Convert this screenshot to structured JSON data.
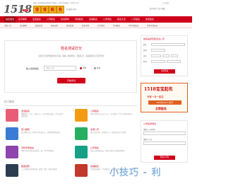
{
  "top_strip": {
    "notice": "看盘人查询网站名测试打分网站，起名打分网站 - 1518.com",
    "right": "宝宝起名"
  },
  "header": {
    "logo_text": "1518",
    "logo_badge": ".com",
    "banner_chars": [
      "宝",
      "宝",
      "起",
      "名"
    ],
    "banner_sub": "宝宝起名大师",
    "right_link": "设为首页 | 加入收藏"
  },
  "nav": {
    "items": [
      "姓名测试",
      "名字解梦",
      "宝宝起名",
      "公司起名",
      "在线算命",
      "周易起名",
      "店铺起名",
      "公司测名",
      "起名大全",
      "八字起名",
      "免费起名"
    ],
    "active_index": 0
  },
  "subnav": {
    "items": [
      "生辰八字",
      "周公解梦",
      "黄道吉日",
      "星座运势",
      "姓氏起源",
      "起名字典",
      "五行查询",
      "生肖配对",
      "QQ号测吉凶",
      "手机号测吉凶"
    ]
  },
  "test_panel": {
    "title": "姓名测试打分",
    "desc": "好的名字是伴随终生的幸福，请输入您的姓名，测试打分，看看您的名字是否吉祥",
    "name_label": "输入您的姓名",
    "name_placeholder": "请输入姓名",
    "gender_male": "男性",
    "gender_female": "女性",
    "submit_label": "开始测试"
  },
  "hot": {
    "heading": "热门服务",
    "services": [
      {
        "name": "宝宝起名",
        "desc": "根据姓氏、生日、生辰八字、五行等综合起名，为宝宝起个吉祥好名",
        "color": "#e85d75",
        "icon": "baby-icon"
      },
      {
        "name": "公司起名",
        "desc": "结合行业特点与五行八字，为公司取一个大气吉利的好名字",
        "color": "#f39c12",
        "icon": "building-icon"
      },
      {
        "name": "周公解梦",
        "desc": "周公解梦大全，梦见什么代表什么，在线查询梦境吉凶",
        "color": "#3a7bd5",
        "icon": "moon-icon"
      },
      {
        "name": "生辰八字",
        "desc": "输入出生时间，在线排八字，分析命局五行与运势",
        "color": "#27ae60",
        "icon": "calendar-icon"
      },
      {
        "name": "手机号测吉凶",
        "desc": "测试手机号码的吉凶好坏，选一个好号码助运",
        "color": "#8e44ad",
        "icon": "phone-icon"
      },
      {
        "name": "公司测名",
        "desc": "测试公司名称吉凶，分析公司名字对运势的影响",
        "color": "#16a085",
        "icon": "chart-icon"
      },
      {
        "name": "星座运势",
        "desc": "十二星座每日运势查询，爱情、事业、财运全知道",
        "color": "#2c3e50",
        "icon": "star-icon"
      },
      {
        "name": "店铺起名",
        "desc": "为您的店铺起一个吉利好记、招财旺铺的名字",
        "color": "#c0392b",
        "icon": "shop-icon"
      }
    ]
  },
  "right": {
    "form1": {
      "title": "姓名是否匹配出生八字",
      "surname_label": "姓氏",
      "gender_label": "性别",
      "birth_label": "出生",
      "time_label": "时间",
      "submit_label": "立即测试"
    },
    "ad": {
      "big": "1518宝宝起名",
      "mid": "专家一对一起名",
      "price": "¥28元200个名字",
      "cta": "立即起名"
    },
    "form2": {
      "title": "公司名称测试",
      "name_label": "请输入公司名称",
      "industry_label": "请输入行业",
      "submit_label": "测试公司名"
    }
  },
  "watermark": "小技巧 - 利"
}
